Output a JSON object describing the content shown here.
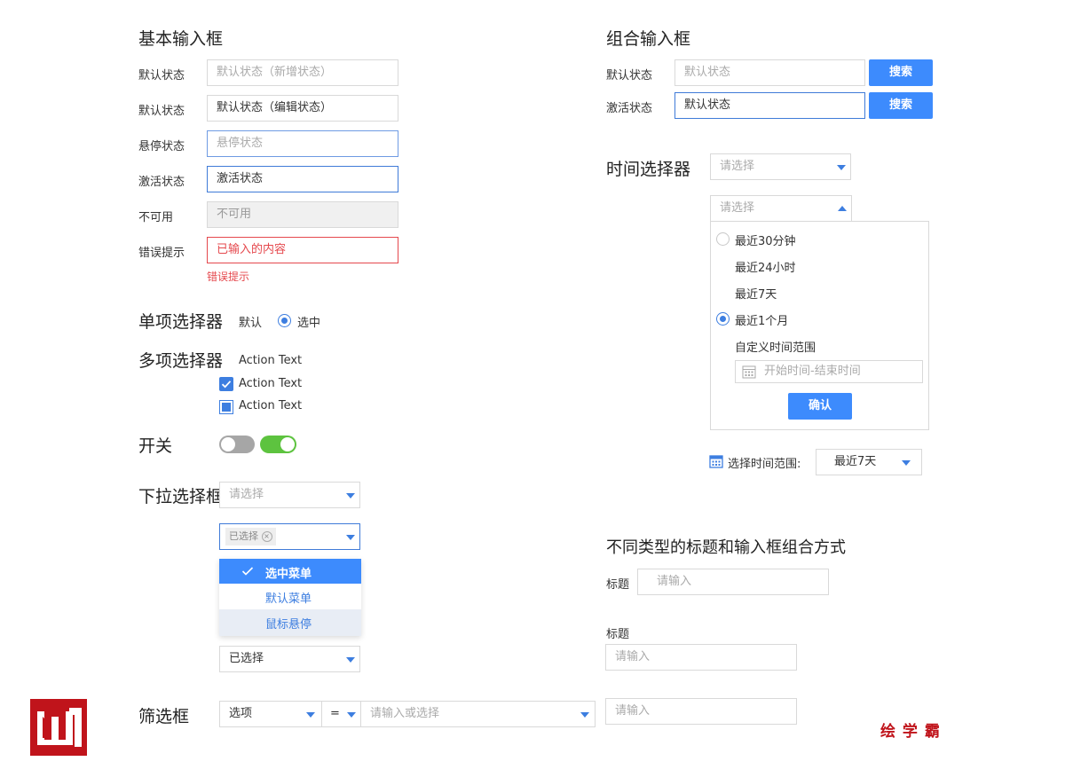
{
  "basic": {
    "title": "基本输入框",
    "rows": [
      {
        "label": "默认状态",
        "value": "默认状态（新增状态）"
      },
      {
        "label": "默认状态",
        "value": "默认状态（编辑状态）"
      },
      {
        "label": "悬停状态",
        "value": "悬停状态"
      },
      {
        "label": "激活状态",
        "value": "激活状态"
      },
      {
        "label": "不可用",
        "value": "不可用"
      },
      {
        "label": "错误提示",
        "value": "已输入的内容"
      }
    ],
    "error_hint": "错误提示"
  },
  "radio": {
    "title": "单项选择器",
    "default_label": "默认",
    "selected_label": "选中"
  },
  "checkbox": {
    "title": "多项选择器",
    "items": [
      "Action Text",
      "Action Text",
      "Action Text"
    ]
  },
  "switch": {
    "title": "开关"
  },
  "dropdown": {
    "title": "下拉选择框",
    "placeholder": "请选择",
    "tag": "已选择",
    "menu": [
      "选中菜单",
      "默认菜单",
      "鼠标悬停"
    ],
    "selected_value": "已选择"
  },
  "filter": {
    "title": "筛选框",
    "field": "选项",
    "operator": "=",
    "placeholder": "请输入或选择"
  },
  "group": {
    "title": "组合输入框",
    "rows": [
      {
        "label": "默认状态",
        "value": "默认状态",
        "button": "搜索"
      },
      {
        "label": "激活状态",
        "value": "默认状态",
        "button": "搜索"
      }
    ]
  },
  "time": {
    "title": "时间选择器",
    "placeholder": "请选择",
    "options": [
      "最近30分钟",
      "最近24小时",
      "最近7天",
      "最近1个月",
      "自定义时间范围"
    ],
    "range_placeholder": "开始时间-结束时间",
    "confirm": "确认",
    "range_label": "选择时间范围:",
    "range_value": "最近7天"
  },
  "combo": {
    "title": "不同类型的标题和输入框组合方式",
    "label1": "标题",
    "placeholder1": "请输入",
    "label2": "标题",
    "placeholder2": "请输入",
    "placeholder3": "请输入"
  },
  "brand": {
    "text": "绘 学 霸",
    "color": "#c0141b"
  },
  "colors": {
    "accent": "#3d8bfd",
    "error": "#e5484d",
    "switch_on": "#5dc33f",
    "switch_off": "#a6a6a6"
  }
}
